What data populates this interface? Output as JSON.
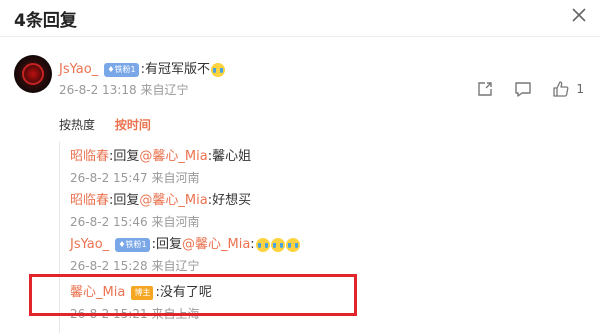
{
  "header": {
    "title": "4条回复"
  },
  "comment": {
    "author": "JsYao_",
    "fan_badge": "铁粉1",
    "text": ":有冠军版不",
    "time": "26-8-2 13:18",
    "location": "来自辽宁",
    "like_count": "1"
  },
  "sort": {
    "by_heat": "按热度",
    "by_time": "按时间"
  },
  "replies": [
    {
      "author": "昭临春",
      "prefix": ":回复",
      "mention": "@馨心_Mia",
      "text": ":馨心姐",
      "time": "26-8-2 15:47",
      "location": "来自河南"
    },
    {
      "author": "昭临春",
      "prefix": ":回复",
      "mention": "@馨心_Mia",
      "text": ":好想买",
      "time": "26-8-2 15:46",
      "location": "来自河南"
    },
    {
      "author": "JsYao_",
      "badge": "铁粉1",
      "prefix": ":回复",
      "mention": "@馨心_Mia",
      "text": ":",
      "time": "26-8-2 15:28",
      "location": "来自辽宁"
    },
    {
      "author": "馨心_Mia",
      "badge": "博主",
      "text": ":没有了呢",
      "time": "26-8-2 15:21",
      "location": "来自上海"
    }
  ],
  "colors": {
    "accent": "#eb7350",
    "highlight": "#e2242d",
    "fan_badge": "#7aa7e8",
    "host_badge": "#f5a623"
  }
}
